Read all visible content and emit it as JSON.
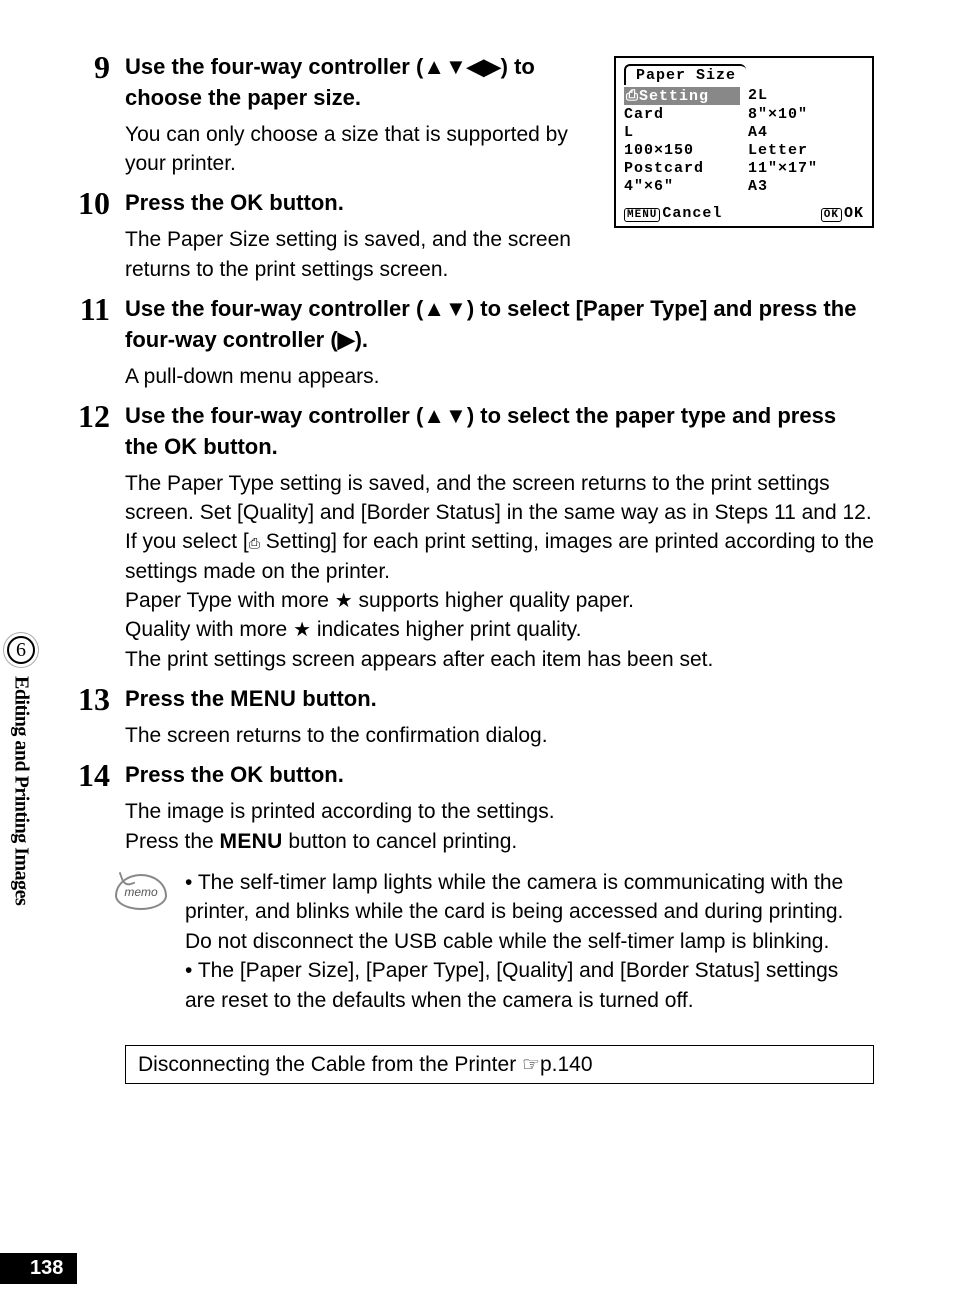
{
  "sidetab": {
    "section_number": "6",
    "section_title": "Editing and Printing Images"
  },
  "lcd": {
    "title": "Paper Size",
    "cells": [
      "⎙Setting",
      "2L",
      "Card",
      "8\"×10\"",
      "L",
      "A4",
      "100×150",
      "Letter",
      "Postcard",
      "11\"×17\"",
      "4\"×6\"",
      "A3"
    ],
    "footer_left_btn": "MENU",
    "footer_left": "Cancel",
    "footer_right_btn": "OK",
    "footer_right": "OK"
  },
  "steps": {
    "s9": {
      "num": "9",
      "title_a": "Use the four-way controller (",
      "title_b": ") to choose the paper size.",
      "arrows": "▲▼◀▶",
      "desc": "You can only choose a size that is supported by your printer."
    },
    "s10": {
      "num": "10",
      "title_a": "Press the ",
      "title_b": " button.",
      "ok": "OK",
      "desc": "The Paper Size setting is saved, and the screen returns to the print settings screen."
    },
    "s11": {
      "num": "11",
      "title_a": "Use the four-way controller (",
      "title_b": ") to select [Paper Type] and press the four-way controller (",
      "title_c": ").",
      "arrows_ud": "▲▼",
      "arrow_r": "▶",
      "desc": "A pull-down menu appears."
    },
    "s12": {
      "num": "12",
      "title_a": "Use the four-way controller (",
      "title_b": ") to select the paper type and press the ",
      "title_c": " button.",
      "arrows_ud": "▲▼",
      "ok": "OK",
      "p1": "The Paper Type setting is saved, and the screen returns to the print settings screen. Set [Quality] and [Border Status] in the same way as in Steps 11 and 12.",
      "p2a": "If you select [",
      "p2b": " Setting] for each print setting, images are printed according to the settings made on the printer.",
      "device": "⎙",
      "p3a": "Paper Type with more ",
      "p3b": " supports higher quality paper.",
      "p4a": "Quality with more ",
      "p4b": " indicates higher print quality.",
      "star": "★",
      "p5": "The print settings screen appears after each item has been set."
    },
    "s13": {
      "num": "13",
      "title_a": "Press the ",
      "title_b": " button.",
      "menu": "MENU",
      "desc": "The screen returns to the confirmation dialog."
    },
    "s14": {
      "num": "14",
      "title_a": "Press the ",
      "title_b": " button.",
      "ok": "OK",
      "p1": "The image is printed according to the settings.",
      "p2a": "Press the ",
      "p2b": " button to cancel printing.",
      "menu": "MENU"
    }
  },
  "memo": {
    "label": "memo",
    "m1": "The self-timer lamp lights while the camera is communicating with the printer, and blinks while the card is being accessed and during printing. Do not disconnect the USB cable while the self-timer lamp is blinking.",
    "m2": "The [Paper Size], [Paper Type], [Quality] and [Border Status] settings are reset to the defaults when the camera is turned off."
  },
  "ref": {
    "text": "Disconnecting the Cable from the Printer ",
    "pointer": "☞",
    "page": "p.140"
  },
  "page_number": "138"
}
